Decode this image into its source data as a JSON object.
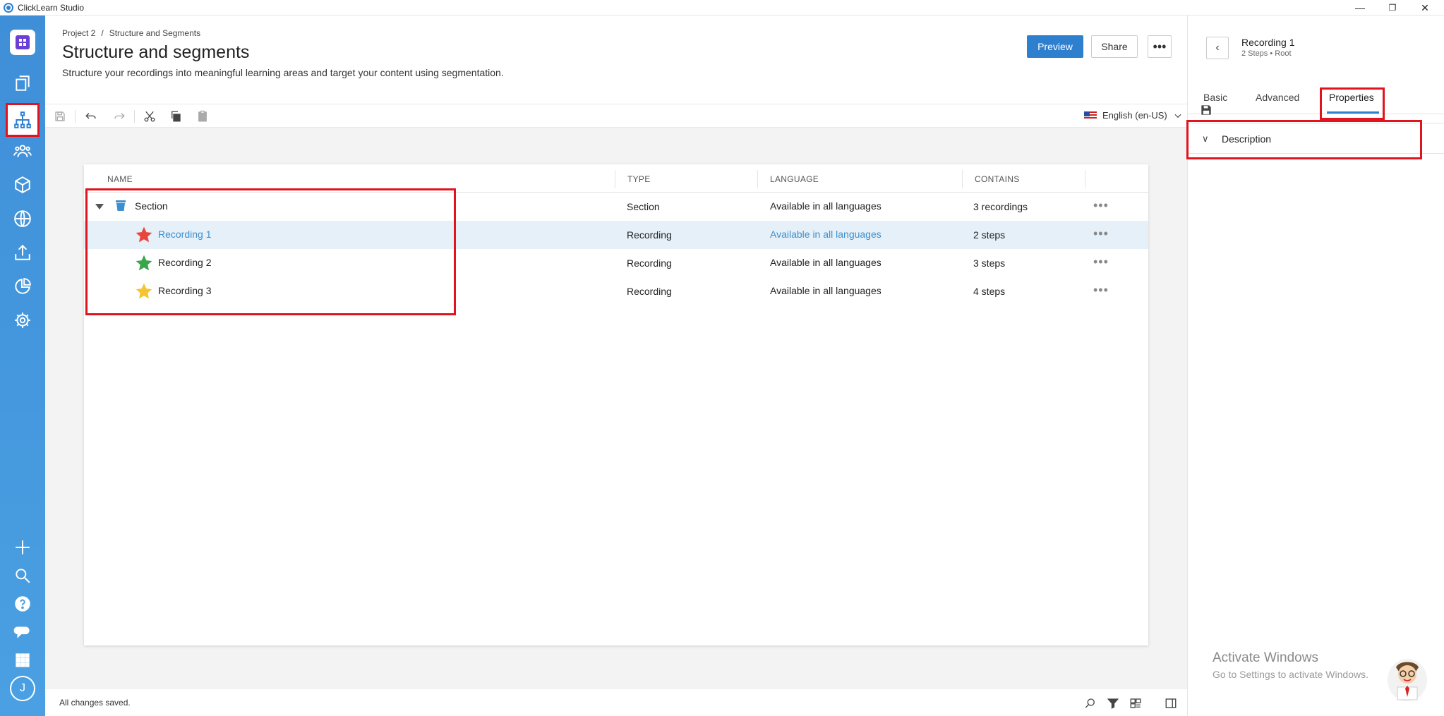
{
  "window": {
    "title": "ClickLearn Studio",
    "controls": [
      "—",
      "❐",
      "✕"
    ]
  },
  "breadcrumb": [
    "Project 2",
    "/",
    "Structure and Segments"
  ],
  "page": {
    "title": "Structure and segments",
    "description": "Structure your recordings into meaningful learning areas and target your content using segmentation."
  },
  "header_buttons": {
    "preview": "Preview",
    "share": "Share",
    "more": "•••"
  },
  "toolbar": {
    "language": "English (en-US)"
  },
  "table": {
    "columns": [
      "NAME",
      "TYPE",
      "LANGUAGE",
      "CONTAINS"
    ],
    "rows": [
      {
        "name": "Section",
        "type": "Section",
        "language": "Available in all languages",
        "contains": "3 recordings",
        "more": "•••"
      },
      {
        "name": "Recording 1",
        "type": "Recording",
        "language": "Available in all languages",
        "contains": "2 steps",
        "more": "•••"
      },
      {
        "name": "Recording 2",
        "type": "Recording",
        "language": "Available in all languages",
        "contains": "3 steps",
        "more": "•••"
      },
      {
        "name": "Recording 3",
        "type": "Recording",
        "language": "Available in all languages",
        "contains": "4 steps",
        "more": "•••"
      }
    ]
  },
  "status": {
    "text": "All changes saved."
  },
  "right_panel": {
    "back": "‹",
    "title": "Recording 1",
    "subtitle": "2 Steps • Root",
    "tabs": [
      "Basic",
      "Advanced",
      "Properties"
    ],
    "section": "Description",
    "chevron": "∨"
  },
  "watermark": {
    "line1": "Activate Windows",
    "line2": "Go to Settings to activate Windows."
  },
  "user": {
    "initial": "J"
  },
  "colors": {
    "accent": "#2f7fcf",
    "rail": "#4a9de0",
    "highlight": "#e0141f",
    "star_red": "#e8453c",
    "star_green": "#3aa64c",
    "star_yellow": "#f5c431"
  }
}
